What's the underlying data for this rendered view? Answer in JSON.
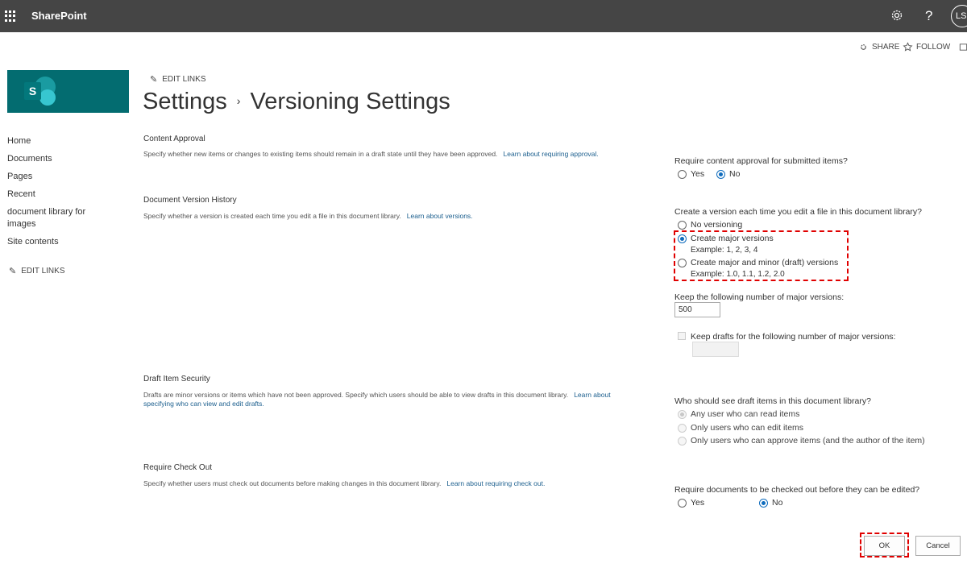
{
  "suite": {
    "brand": "SharePoint",
    "avatar_initials": "LS",
    "icons": [
      "waffle-icon",
      "gear-icon",
      "help-icon"
    ]
  },
  "actions": {
    "share": "SHARE",
    "follow": "FOLLOW"
  },
  "nav": {
    "items": [
      "Home",
      "Documents",
      "Pages",
      "Recent",
      "document library for images",
      "Site contents"
    ],
    "edit_links": "EDIT LINKS"
  },
  "header": {
    "edit_links": "EDIT LINKS",
    "title_part1": "Settings",
    "separator": "›",
    "title_part2": "Versioning Settings"
  },
  "sections": {
    "content_approval": {
      "title": "Content Approval",
      "desc": "Specify whether new items or changes to existing items should remain in a draft state until they have been approved.",
      "link": "Learn about requiring approval.",
      "question": "Require content approval for submitted items?",
      "options": [
        "Yes",
        "No"
      ],
      "selected": "No"
    },
    "version_history": {
      "title": "Document Version History",
      "desc": "Specify whether a version is created each time you edit a file in this document library.",
      "link": "Learn about versions.",
      "question": "Create a version each time you edit a file in this document library?",
      "opt_none": "No versioning",
      "opt_major": "Create major versions",
      "opt_major_example": "Example: 1, 2, 3, 4",
      "opt_minor": "Create major and minor (draft) versions",
      "opt_minor_example": "Example: 1.0, 1.1, 1.2, 2.0",
      "selected": "Create major versions",
      "keep_major_label": "Keep the following number of major versions:",
      "keep_major_value": "500",
      "keep_drafts_label": "Keep drafts for the following number of major versions:"
    },
    "draft_security": {
      "title": "Draft Item Security",
      "desc": "Drafts are minor versions or items which have not been approved. Specify which users should be able to view drafts in this document library.",
      "link": "Learn about specifying who can view and edit drafts.",
      "question": "Who should see draft items in this document library?",
      "options": [
        "Any user who can read items",
        "Only users who can edit items",
        "Only users who can approve items (and the author of the item)"
      ],
      "selected": "Any user who can read items"
    },
    "check_out": {
      "title": "Require Check Out",
      "desc": "Specify whether users must check out documents before making changes in this document library.",
      "link": "Learn about requiring check out.",
      "question": "Require documents to be checked out before they can be edited?",
      "options": [
        "Yes",
        "No"
      ],
      "selected": "No"
    }
  },
  "buttons": {
    "ok": "OK",
    "cancel": "Cancel"
  },
  "colors": {
    "suitebar": "#454545",
    "logo_bg": "#036c70",
    "link": "#1c5f8e",
    "radio_selected": "#0f6cbd",
    "highlight": "#e00000"
  }
}
